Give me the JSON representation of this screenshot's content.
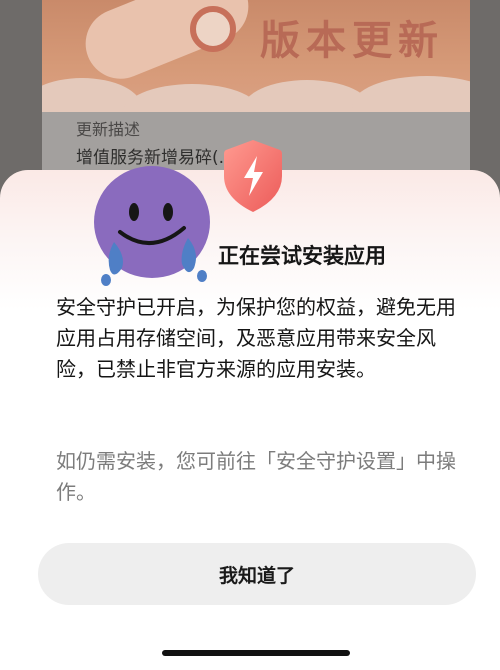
{
  "background_dialog": {
    "banner_title": "版本更新",
    "description_label": "更新描述",
    "description_text": "增值服务新增易碎(...)"
  },
  "security_sheet": {
    "title": "正在尝试安装应用",
    "body": "安全守护已开启，为保护您的权益，避免无用应用占用存储空间，及恶意应用带来安全风险，已禁止非官方来源的应用安装。",
    "hint": "如仍需安装，您可前往「安全守护设置」中操作。",
    "confirm_button_label": "我知道了",
    "shield_icon": "lightning-shield-icon"
  },
  "sticker": {
    "icon": "crying-face-emoji"
  },
  "colors": {
    "sheet_tint": "#fbe9e6",
    "shield_red": "#f0706a",
    "button_bg": "#eeeeee",
    "sticker_purple": "#8a6bbe",
    "tear_blue": "#4f7fc6"
  }
}
